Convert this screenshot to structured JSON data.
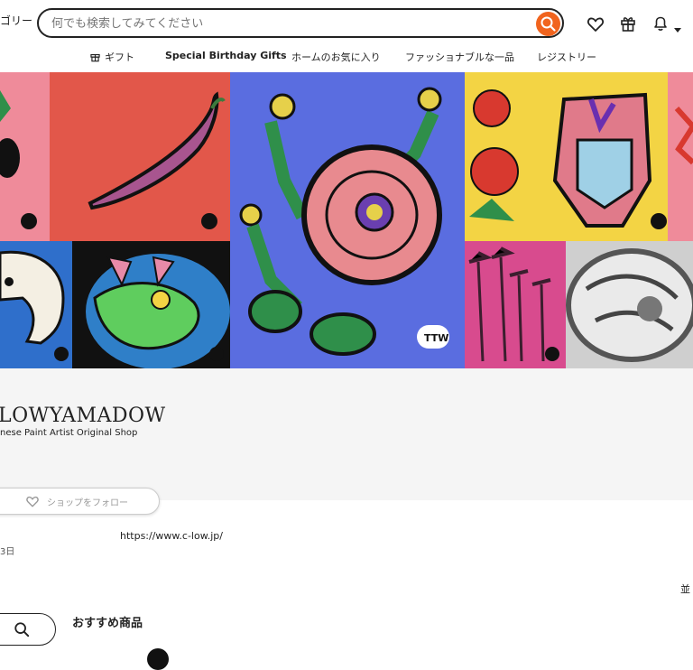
{
  "header": {
    "category_label": "ゴリー",
    "search_placeholder": "何でも検索してみてください",
    "nav_tabs": [
      {
        "label": "ギフト",
        "icon": "gift-icon"
      },
      {
        "label": "Special Birthday Gifts"
      },
      {
        "label": "ホームのお気に入り"
      },
      {
        "label": "ファッショナブルな一品"
      },
      {
        "label": "レジストリー"
      }
    ],
    "icons": [
      "search-icon",
      "heart-icon",
      "gift-icon",
      "bell-icon",
      "caret-down-icon"
    ]
  },
  "banner": {
    "watermark": "TTW",
    "accent_colors": [
      "#e85a4f",
      "#5b6ee1",
      "#f2d13c",
      "#2f6fcb",
      "#d84b8e"
    ]
  },
  "shop": {
    "name": "LOWYAMADOW",
    "tagline": "nese Paint Artist Original Shop",
    "follow_label": "ショップをフォロー",
    "website": "https://www.c-low.jp/",
    "date_fragment": "3日"
  },
  "listing": {
    "sort_label": "並",
    "featured_title": "おすすめ商品"
  },
  "colors": {
    "accent": "#f1641e",
    "text": "#222222",
    "muted_bg": "#f5f5f5"
  }
}
